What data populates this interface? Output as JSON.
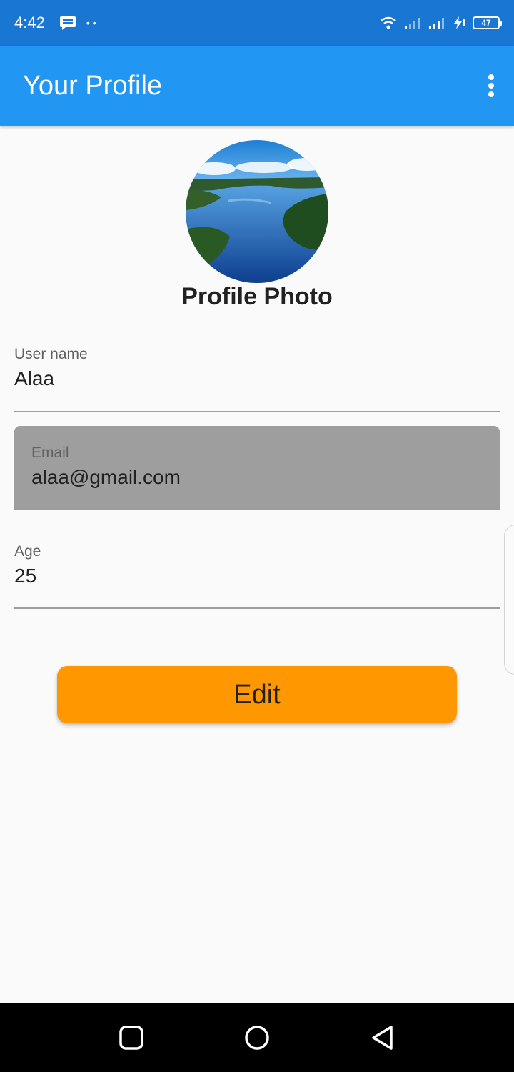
{
  "status_bar": {
    "time": "4:42",
    "dots": "••",
    "battery_level": "47",
    "icons": [
      "message-icon",
      "wifi-icon",
      "signal-icon",
      "signal-icon",
      "charging-icon",
      "battery-icon"
    ]
  },
  "app_bar": {
    "title": "Your Profile",
    "menu_icon": "more-vert-icon"
  },
  "profile": {
    "photo_label": "Profile Photo",
    "photo_description_icon": "lake-landscape-image"
  },
  "fields": {
    "username": {
      "label": "User name",
      "value": "Alaa"
    },
    "email": {
      "label": "Email",
      "value": "alaa@gmail.com"
    },
    "age": {
      "label": "Age",
      "value": "25"
    }
  },
  "actions": {
    "edit_label": "Edit"
  },
  "colors": {
    "status_bar": "#1976d2",
    "app_bar": "#2196f3",
    "edit_button": "#ff9800",
    "email_field_bg": "#9e9e9e",
    "background": "#fafafa"
  },
  "nav_bar": {
    "icons": [
      "recents-square-icon",
      "home-circle-icon",
      "back-triangle-icon"
    ]
  }
}
